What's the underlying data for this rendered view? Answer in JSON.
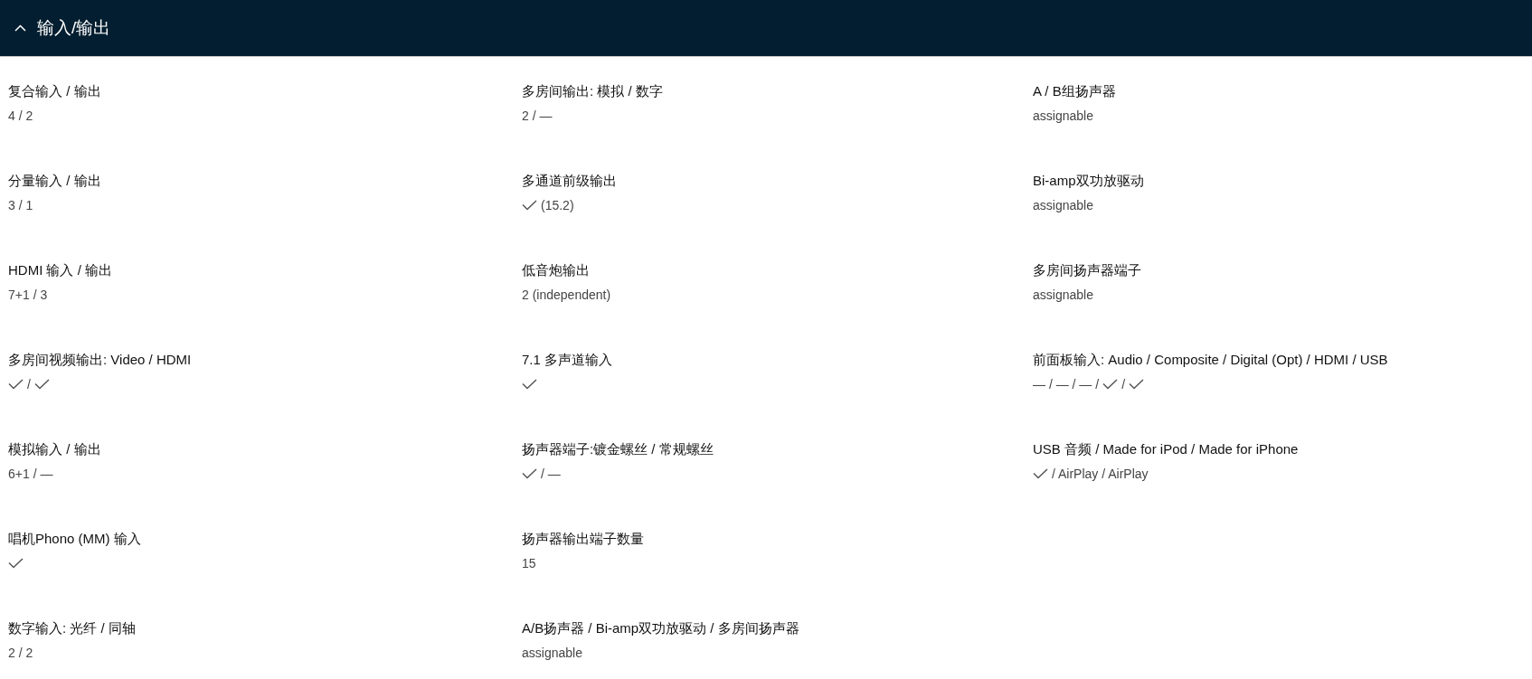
{
  "section": {
    "title": "输入/输出",
    "expanded": true
  },
  "columns": [
    [
      {
        "label": "复合输入 / 输出",
        "value": [
          {
            "kind": "text",
            "text": "4 / 2"
          }
        ]
      },
      {
        "label": "分量输入 / 输出",
        "value": [
          {
            "kind": "text",
            "text": "3 / 1"
          }
        ]
      },
      {
        "label": "HDMI 输入 / 输出",
        "value": [
          {
            "kind": "text",
            "text": "7+1 / 3"
          }
        ]
      },
      {
        "label": "多房间视频输出: Video / HDMI",
        "value": [
          {
            "kind": "check"
          },
          {
            "kind": "text",
            "text": "/"
          },
          {
            "kind": "check"
          }
        ]
      },
      {
        "label": "模拟输入 / 输出",
        "value": [
          {
            "kind": "text",
            "text": "6+1 / —"
          }
        ]
      },
      {
        "label": "唱机Phono (MM) 输入",
        "value": [
          {
            "kind": "check"
          }
        ]
      },
      {
        "label": "数字输入: 光纤 / 同轴",
        "value": [
          {
            "kind": "text",
            "text": "2 / 2"
          }
        ]
      }
    ],
    [
      {
        "label": "多房间输出: 模拟 / 数字",
        "value": [
          {
            "kind": "text",
            "text": "2 / —"
          }
        ]
      },
      {
        "label": "多通道前级输出",
        "value": [
          {
            "kind": "check"
          },
          {
            "kind": "text",
            "text": "(15.2)"
          }
        ]
      },
      {
        "label": "低音炮输出",
        "value": [
          {
            "kind": "text",
            "text": "2 (independent)"
          }
        ]
      },
      {
        "label": "7.1 多声道输入",
        "value": [
          {
            "kind": "check"
          }
        ]
      },
      {
        "label": "扬声器端子:镀金螺丝 / 常规螺丝",
        "value": [
          {
            "kind": "check"
          },
          {
            "kind": "text",
            "text": "/ —"
          }
        ]
      },
      {
        "label": "扬声器输出端子数量",
        "value": [
          {
            "kind": "text",
            "text": "15"
          }
        ]
      },
      {
        "label": "A/B扬声器 / Bi-amp双功放驱动 / 多房间扬声器",
        "value": [
          {
            "kind": "text",
            "text": "assignable"
          }
        ]
      }
    ],
    [
      {
        "label": "A / B组扬声器",
        "value": [
          {
            "kind": "text",
            "text": "assignable"
          }
        ]
      },
      {
        "label": "Bi-amp双功放驱动",
        "value": [
          {
            "kind": "text",
            "text": "assignable"
          }
        ]
      },
      {
        "label": "多房间扬声器端子",
        "value": [
          {
            "kind": "text",
            "text": "assignable"
          }
        ]
      },
      {
        "label": "前面板输入: Audio / Composite / Digital (Opt) / HDMI / USB",
        "value": [
          {
            "kind": "text",
            "text": "— / — / — /"
          },
          {
            "kind": "check"
          },
          {
            "kind": "text",
            "text": "/"
          },
          {
            "kind": "check"
          }
        ]
      },
      {
        "label": "USB 音频 / Made for iPod / Made for iPhone",
        "value": [
          {
            "kind": "check"
          },
          {
            "kind": "text",
            "text": "/ AirPlay / AirPlay"
          }
        ]
      }
    ]
  ]
}
